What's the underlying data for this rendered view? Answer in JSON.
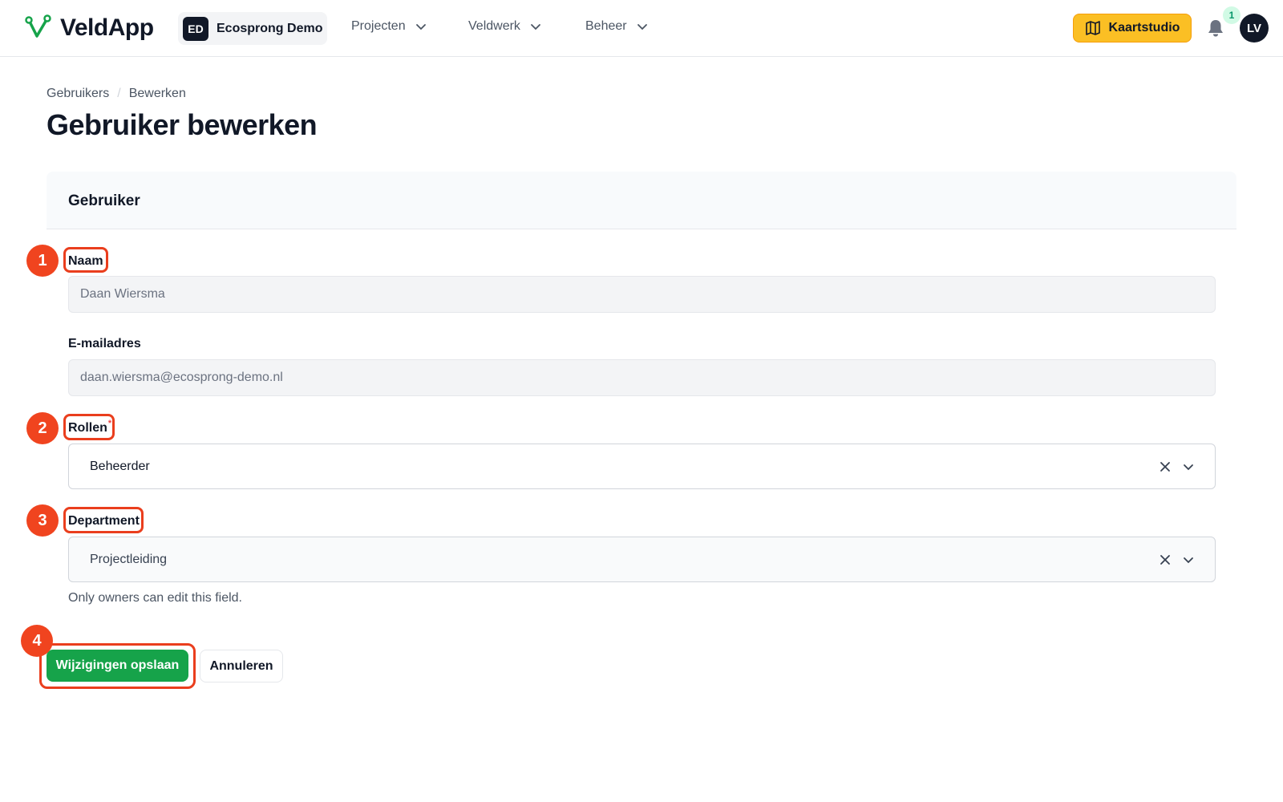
{
  "app": {
    "name": "VeldApp"
  },
  "workspace": {
    "initials": "ED",
    "name": "Ecosprong Demo"
  },
  "nav": [
    {
      "label": "Projecten"
    },
    {
      "label": "Veldwerk"
    },
    {
      "label": "Beheer"
    }
  ],
  "header": {
    "map_button_label": "Kaartstudio",
    "notification_count": "1",
    "avatar_initials": "LV"
  },
  "breadcrumb": {
    "items": [
      "Gebruikers",
      "Bewerken"
    ],
    "separator": "/"
  },
  "page": {
    "title": "Gebruiker bewerken"
  },
  "section": {
    "title": "Gebruiker"
  },
  "form": {
    "name": {
      "label": "Naam",
      "value": "Daan Wiersma"
    },
    "email": {
      "label": "E-mailadres",
      "value": "daan.wiersma@ecosprong-demo.nl"
    },
    "roles": {
      "label": "Rollen",
      "required_mark": "*",
      "value": "Beheerder"
    },
    "department": {
      "label": "Department",
      "value": "Projectleiding",
      "helper": "Only owners can edit this field."
    }
  },
  "actions": {
    "save_label": "Wijzigingen opslaan",
    "cancel_label": "Annuleren"
  },
  "annotations": [
    "1",
    "2",
    "3",
    "4"
  ],
  "colors": {
    "accent": "#fbbf24",
    "primary": "#16a34a",
    "annotation": "#f0441f"
  }
}
